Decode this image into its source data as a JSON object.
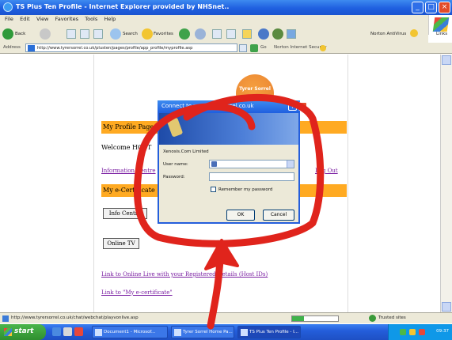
{
  "window": {
    "title": "TS Plus Ten Profile - Internet Explorer provided by NHSnet.."
  },
  "menu": [
    "File",
    "Edit",
    "View",
    "Favorites",
    "Tools",
    "Help"
  ],
  "toolbar": {
    "back_label": "Back",
    "search_label": "Search",
    "favorites_label": "Favorites",
    "norton_label": "Norton AntiVirus",
    "links_label": "Links"
  },
  "address": {
    "label": "Address",
    "url": "http://www.tyrersorrel.co.uk/plusten/pages/profile/app_profile/myprofile.asp",
    "go_label": "Go",
    "security_label": "Norton Internet Security"
  },
  "page": {
    "logo_text": "Tyrer Sorrel",
    "profile_heading": "My Profile Page",
    "welcome_text": "Welcome HOST",
    "info_centre_link": "Information Centre",
    "logout_link": "Log Out",
    "certificate_heading": "My e-Certificate",
    "info_button": "Info Centre",
    "online_tv_button": "Online TV",
    "online_live_link": "Link to Online Live with your Registered Details (Host IDs)",
    "my_certificate_link": "Link to \"My e-certificate\""
  },
  "dialog": {
    "title": "Connect to www.tyrersorrel.co.uk",
    "company": "Xenosis.Com Limited",
    "username_label": "User name:",
    "password_label": "Password:",
    "remember_label": "Remember my password",
    "ok_label": "OK",
    "cancel_label": "Cancel"
  },
  "status": {
    "url": "http://www.tyrersorrel.co.uk/chat/webchat/playvonlive.asp",
    "progress": 0.25,
    "zone": "Trusted sites"
  },
  "taskbar": {
    "start_label": "start",
    "tasks": [
      "Document1 - Microsof...",
      "Tyrer Sorrel Home Pa...",
      "TS Plus Ten Profile - I..."
    ],
    "clock": "09:37"
  },
  "colors": {
    "heading_bar": "#ffaa22",
    "annotation": "#e0241c",
    "xp_blue": "#245edb",
    "link": "#7a1fa2"
  }
}
